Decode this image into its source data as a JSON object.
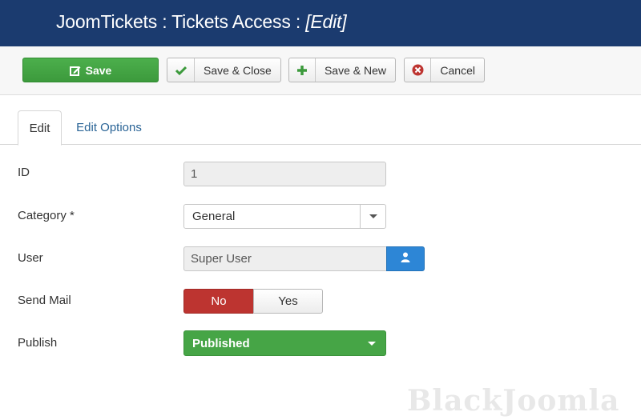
{
  "header": {
    "title_prefix": "JoomTickets : Tickets Access : ",
    "title_action": "[Edit]",
    "background_color": "#1b3b6f"
  },
  "toolbar": {
    "save_label": "Save",
    "save_icon": "edit-icon",
    "save_close_label": "Save & Close",
    "save_close_icon": "check-icon",
    "save_new_label": "Save & New",
    "save_new_icon": "plus-icon",
    "cancel_label": "Cancel",
    "cancel_icon": "cancel-circle-icon"
  },
  "tabs": [
    {
      "label": "Edit",
      "active": true
    },
    {
      "label": "Edit Options",
      "active": false
    }
  ],
  "form": {
    "id": {
      "label": "ID",
      "value": "1"
    },
    "category": {
      "label": "Category *",
      "value": "General"
    },
    "user": {
      "label": "User",
      "value": "Super User",
      "button_icon": "user-icon"
    },
    "send_mail": {
      "label": "Send Mail",
      "options": [
        "No",
        "Yes"
      ],
      "selected": "No"
    },
    "publish": {
      "label": "Publish",
      "value": "Published"
    }
  },
  "colors": {
    "save_green": "#3c9a3c",
    "no_red": "#bd3430",
    "user_blue": "#2d86d6",
    "published_green": "#46a546"
  },
  "watermark": "BlackJoomla"
}
